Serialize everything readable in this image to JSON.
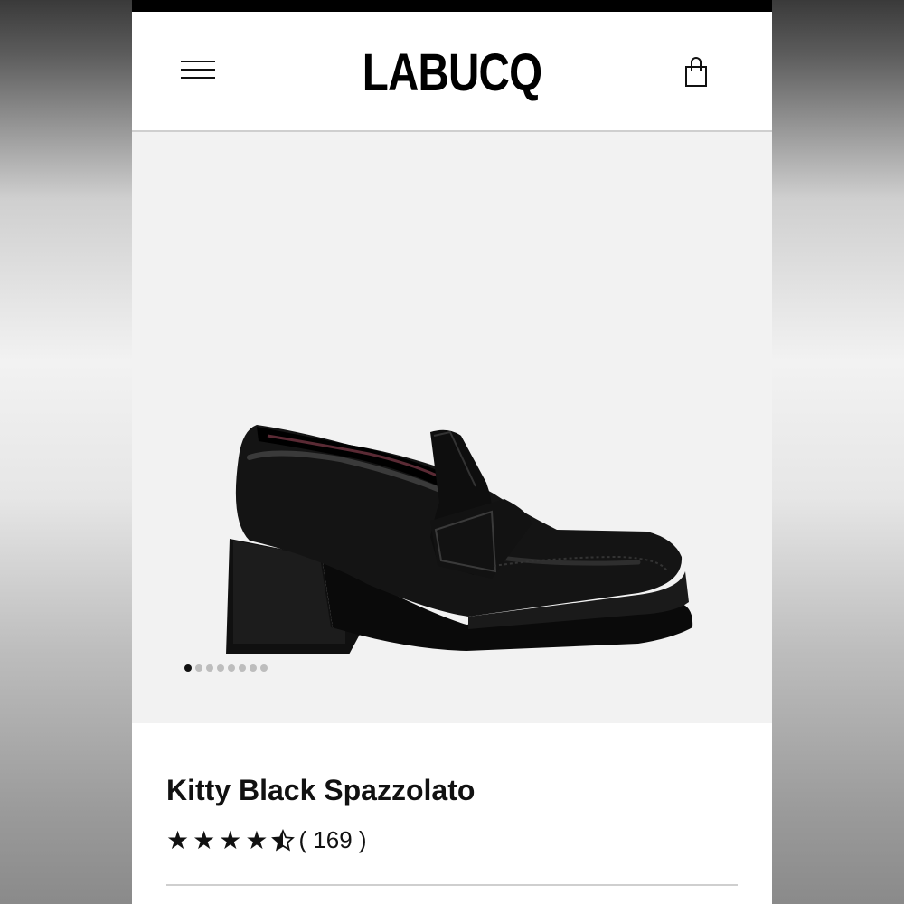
{
  "header": {
    "logo": "LABUCQ",
    "menu_icon": "hamburger-menu-icon",
    "bag_icon": "shopping-bag-icon"
  },
  "gallery": {
    "image_alt": "black-loafer-product-image",
    "dot_count": 8,
    "active_index": 0
  },
  "product": {
    "title": "Kitty Black Spazzolato",
    "rating_value": 4.5,
    "rating_max": 5,
    "review_count_text": "( 169 )"
  },
  "colors": {
    "text": "#111111",
    "hero_bg": "#f2f2f2",
    "dot_inactive": "#bdbdbd"
  }
}
